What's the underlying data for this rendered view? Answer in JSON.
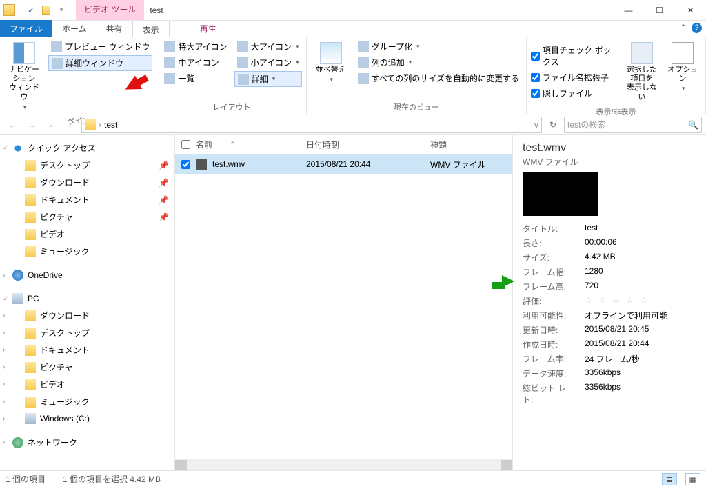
{
  "title": "test",
  "tool_tab": "ビデオ ツール",
  "tabs": {
    "file": "ファイル",
    "home": "ホーム",
    "share": "共有",
    "view": "表示",
    "play": "再生"
  },
  "ribbon": {
    "panes": {
      "label": "ペイン",
      "nav": "ナビゲーション\nウィンドウ",
      "preview": "プレビュー ウィンドウ",
      "details": "詳細ウィンドウ"
    },
    "layout": {
      "label": "レイアウト",
      "xl": "特大アイコン",
      "l": "大アイコン",
      "m": "中アイコン",
      "s": "小アイコン",
      "list": "一覧",
      "details": "詳細"
    },
    "current": {
      "label": "現在のビュー",
      "sort": "並べ替え",
      "group": "グループ化",
      "addcol": "列の追加",
      "autofit": "すべての列のサイズを自動的に変更する"
    },
    "showhide": {
      "label": "表示/非表示",
      "itemcheck": "項目チェック ボックス",
      "ext": "ファイル名拡張子",
      "hidden": "隠しファイル",
      "hidesel": "選択した項目を\n表示しない",
      "options": "オプション"
    }
  },
  "addr": {
    "path": "test",
    "refresh": "↻",
    "dd": "v",
    "search_ph": "testの検索"
  },
  "nav": {
    "quick": "クイック アクセス",
    "desktop": "デスクトップ",
    "downloads": "ダウンロード",
    "documents": "ドキュメント",
    "pictures": "ピクチャ",
    "videos": "ビデオ",
    "music": "ミュージック",
    "onedrive": "OneDrive",
    "pc": "PC",
    "windows_c": "Windows (C:)",
    "network": "ネットワーク"
  },
  "cols": {
    "name": "名前",
    "date": "日付時刻",
    "type": "種類"
  },
  "files": [
    {
      "name": "test.wmv",
      "date": "2015/08/21 20:44",
      "type": "WMV ファイル"
    }
  ],
  "detail": {
    "title": "test.wmv",
    "subtitle": "WMV ファイル",
    "rows": [
      {
        "k": "タイトル:",
        "v": "test"
      },
      {
        "k": "長さ:",
        "v": "00:00:06"
      },
      {
        "k": "サイズ:",
        "v": "4.42 MB"
      },
      {
        "k": "フレーム幅:",
        "v": "1280"
      },
      {
        "k": "フレーム高:",
        "v": "720"
      },
      {
        "k": "評価:",
        "v": "☆ ☆ ☆ ☆ ☆"
      },
      {
        "k": "利用可能性:",
        "v": "オフラインで利用可能"
      },
      {
        "k": "更新日時:",
        "v": "2015/08/21 20:45"
      },
      {
        "k": "作成日時:",
        "v": "2015/08/21 20:44"
      },
      {
        "k": "フレーム率:",
        "v": "24 フレーム/秒"
      },
      {
        "k": "データ速度:",
        "v": "3356kbps"
      },
      {
        "k": "総ビット レート:",
        "v": "3356kbps"
      }
    ]
  },
  "status": {
    "count": "1 個の項目",
    "sel": "1 個の項目を選択 4.42 MB"
  }
}
